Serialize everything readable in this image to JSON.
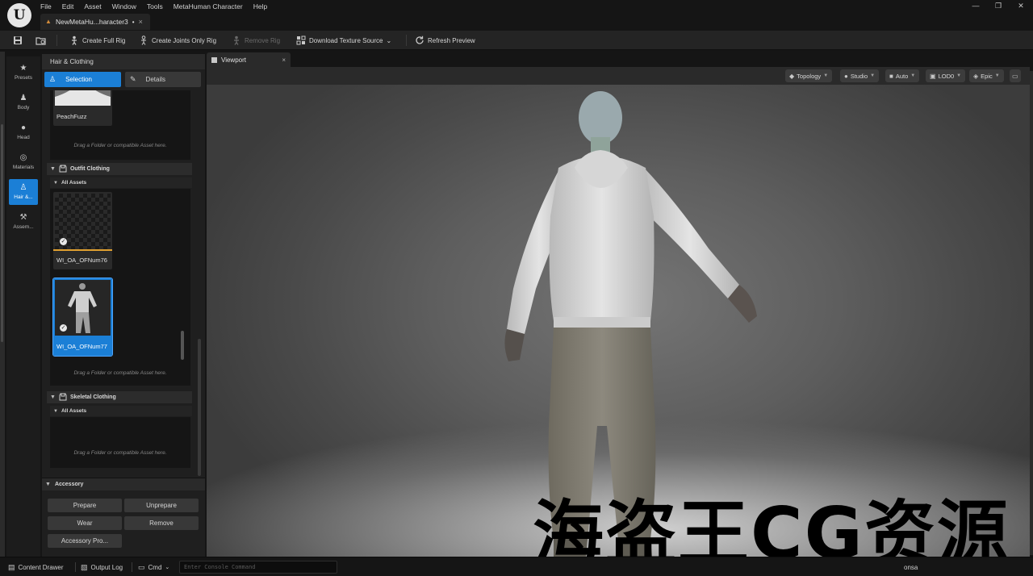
{
  "app": {
    "logo_text": "U",
    "menu": [
      "File",
      "Edit",
      "Asset",
      "Window",
      "Tools",
      "MetaHuman Character",
      "Help"
    ],
    "document_tab": {
      "label": "NewMetaHu...haracter3",
      "modified": "•",
      "close": "×"
    },
    "window_controls": {
      "minimize": "—",
      "restore": "❐",
      "close": "✕"
    }
  },
  "toolbar": {
    "save_icon": "save-icon",
    "browse_icon": "browse-icon",
    "buttons": [
      {
        "label": "Create Full Rig",
        "icon": "rig-icon",
        "enabled": true
      },
      {
        "label": "Create Joints Only Rig",
        "icon": "joints-icon",
        "enabled": true
      },
      {
        "label": "Remove Rig",
        "icon": "remove-rig-icon",
        "enabled": false
      },
      {
        "label": "Download Texture Source",
        "icon": "texture-icon",
        "enabled": true,
        "has_dropdown": true
      },
      {
        "label": "Refresh Preview",
        "icon": "refresh-icon",
        "enabled": true
      }
    ],
    "dropdown_caret": "⌄"
  },
  "rail": {
    "items": [
      {
        "label": "Presets",
        "icon": "★",
        "active": false
      },
      {
        "label": "Body",
        "icon": "♟",
        "active": false
      },
      {
        "label": "Head",
        "icon": "●",
        "active": false
      },
      {
        "label": "Materials",
        "icon": "◎",
        "active": false
      },
      {
        "label": "Hair &...",
        "icon": "♙",
        "active": true
      },
      {
        "label": "Assem...",
        "icon": "⚒",
        "active": false
      }
    ]
  },
  "panel": {
    "title": "Hair & Clothing",
    "tabs": [
      {
        "label": "Selection",
        "icon": "♙",
        "active": true
      },
      {
        "label": "Details",
        "icon": "✎",
        "active": false
      }
    ],
    "top_asset": {
      "label": "PeachFuzz"
    },
    "drop_hint": "Drag a Folder or compatible Asset here.",
    "sections": [
      {
        "label": "Outfit Clothing",
        "sub_label": "All Assets",
        "assets": [
          {
            "label": "WI_OA_OFNum76",
            "selected": false,
            "checked": true
          },
          {
            "label": "WI_OA_OFNum77",
            "selected": true,
            "checked": true
          }
        ]
      },
      {
        "label": "Skeletal Clothing",
        "sub_label": "All Assets",
        "assets": []
      }
    ],
    "accessory": {
      "label": "Accessory",
      "buttons": [
        "Prepare",
        "Unprepare",
        "Wear",
        "Remove",
        "Accessory Pro..."
      ]
    }
  },
  "viewport": {
    "tab_label": "Viewport",
    "tab_close": "×",
    "controls": [
      {
        "label": "Topology",
        "icon": "topology-icon"
      },
      {
        "label": "Studio",
        "icon": "light-icon"
      },
      {
        "label": "Auto",
        "icon": "camera-icon"
      },
      {
        "label": "LOD0",
        "icon": "lod-icon"
      },
      {
        "label": "Epic",
        "icon": "quality-icon"
      }
    ],
    "more_icon": "menu-icon"
  },
  "watermark": "海盗王CG资源",
  "statusbar": {
    "content_drawer": "Content Drawer",
    "output_log": "Output Log",
    "cmd": "Cmd",
    "console_placeholder": "Enter Console Command",
    "right_text": "onsa"
  },
  "colors": {
    "accent": "#1b7fd6",
    "asset_bar": "#e0a030",
    "background": "#151515"
  }
}
